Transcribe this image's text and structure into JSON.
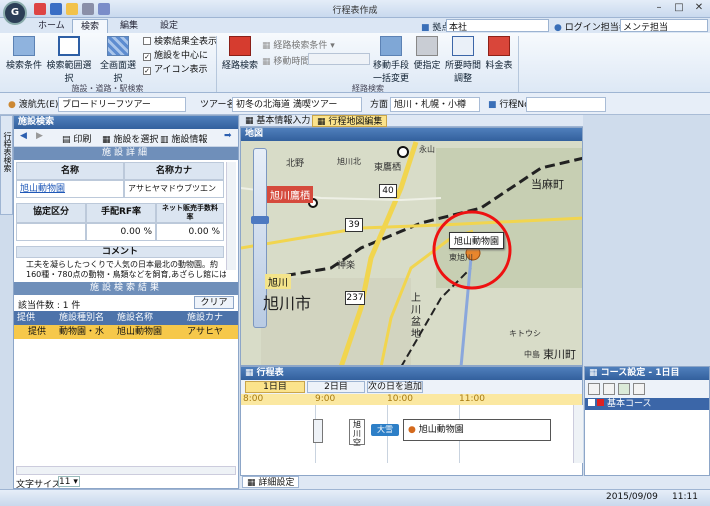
{
  "window": {
    "title": "行程表作成"
  },
  "menu": {
    "tabs": [
      "ホーム",
      "検索",
      "編集",
      "設定"
    ]
  },
  "header": {
    "office_label": "拠点名",
    "office_value": "本社",
    "login_label": "ログイン担当者",
    "login_value": "メンテ担当"
  },
  "ribbon": {
    "btn_search_cond": "検索条件",
    "btn_range_select": "検索範囲選択",
    "btn_full_select": "全画面選択",
    "chk_show_all": "検索結果全表示",
    "chk_center": "施設を中心に",
    "chk_icon": "アイコン表示",
    "group_left": "施設・道路・駅検索",
    "btn_route_search": "経路検索",
    "route_cond": "経路検索条件",
    "move_time": "移動時間",
    "btn_move_batch": "移動手段\n一括変更",
    "btn_convenience": "便指定",
    "btn_required_time": "所要時間\n調整",
    "btn_fee": "料金表",
    "group_right": "経路検索"
  },
  "infobar": {
    "travel_label": "渡航先(E)",
    "travel_value": "ブロードリーフツアー",
    "tour_label": "ツアー名",
    "tour_value": "初冬の北海道 満喫ツアー",
    "dir_label": "方面",
    "dir_value": "旭川・札幌・小樽",
    "itin_label": "行程No."
  },
  "side_tab": "行程表検索",
  "left": {
    "panel_title": "施設検索",
    "tb_print": "印刷",
    "tb_select": "施設を選択",
    "tb_info": "施設情報",
    "detail_header": "施設詳細",
    "col_name": "名称",
    "col_kana": "名称カナ",
    "name": "旭山動物園",
    "kana": "アサヒヤマドウブツエン",
    "col_cat": "協定区分",
    "col_fee": "手配RF率",
    "col_net": "ネット販売手数料率",
    "fee_val": "0.00 %",
    "net_val": "0.00 %",
    "comment_label": "コメント",
    "comment_line1": "工夫を凝らしたつくりで人気の日本最北の動物園。約",
    "comment_line2": "160種・780点の動物・鳥類などを飼育,あざらし館には、",
    "result_header": "施設検索結果",
    "count": "該当件数 : 1 件",
    "clear": "クリア",
    "cols": [
      "提供",
      "施設種別名",
      "施設名称",
      "施設カナ"
    ],
    "row": [
      "提供",
      "動物園・水",
      "旭山動物園",
      "アサヒヤ"
    ],
    "font_label": "文字サイズ",
    "font_value": "11"
  },
  "center_tabs": {
    "basic": "基本情報入力",
    "map_edit": "行程地図編集"
  },
  "map": {
    "title": "地図",
    "labels": [
      "北野",
      "東鷹栖",
      "永山",
      "当麻町",
      "旭川鷹栖",
      "旭川北",
      "神楽",
      "東旭川",
      "上川盆地",
      "旭川",
      "旭川市",
      "東川町",
      "中島",
      "キトウシ"
    ],
    "route_nums": [
      "40",
      "39",
      "237"
    ],
    "popup": "旭山動物園"
  },
  "schedule": {
    "title": "行程表",
    "day1": "1日目",
    "day2": "2日目",
    "add": "次の日を追加",
    "times": [
      "8:00",
      "9:00",
      "10:00",
      "11:00"
    ],
    "stop": "旭川空",
    "item": "旭山動物園",
    "ship": "大雪"
  },
  "course": {
    "title": "コース設定 - 1日目",
    "item": "基本コース"
  },
  "bottom_tab": "詳細設定",
  "status": {
    "date": "2015/09/09",
    "time": "11:11"
  }
}
